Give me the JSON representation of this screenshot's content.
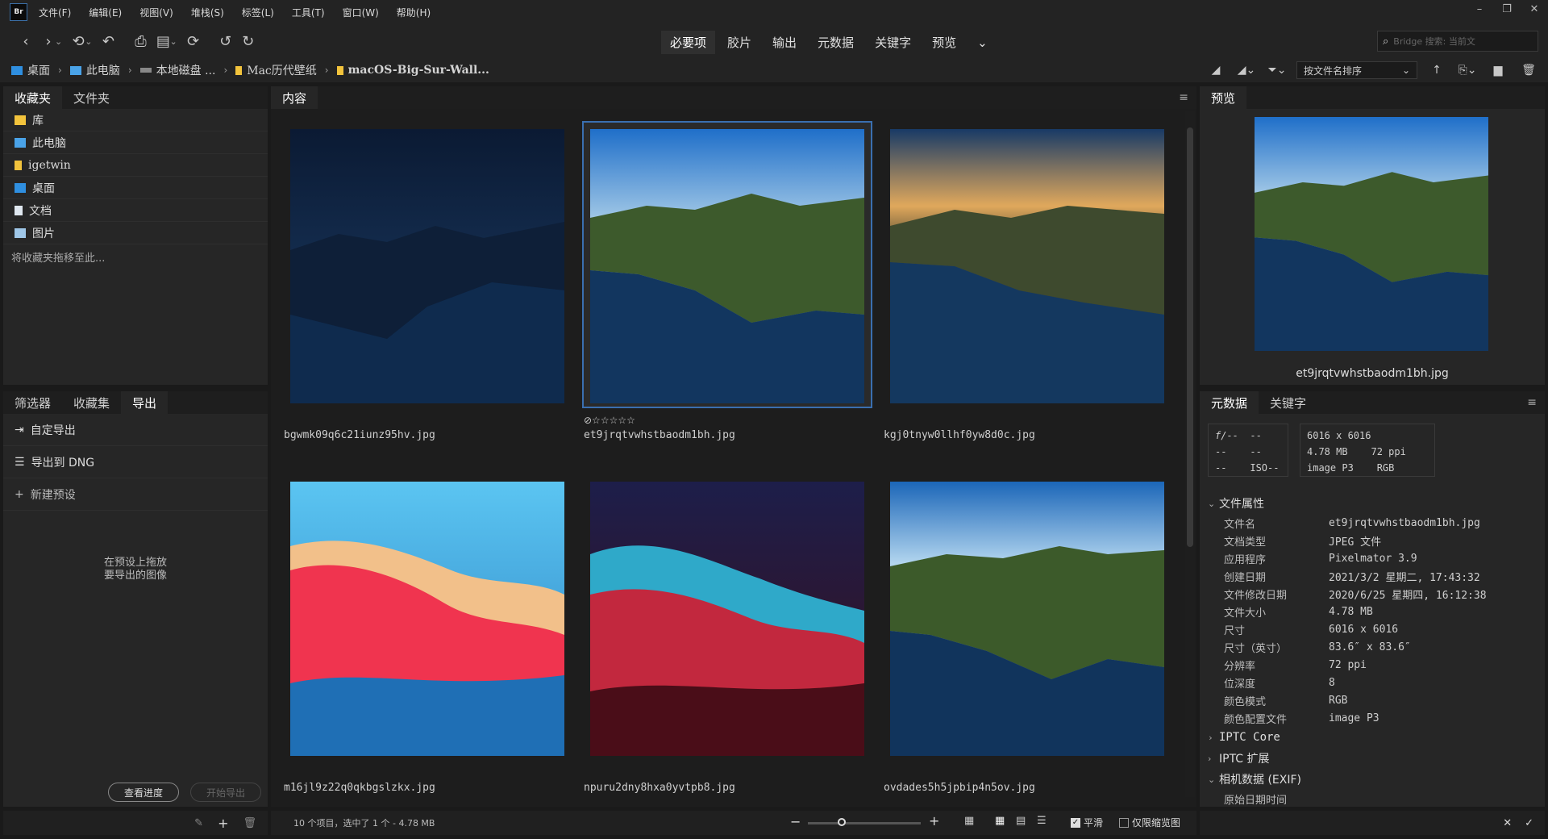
{
  "app": {
    "icon": "Br"
  },
  "menu": [
    "文件(F)",
    "编辑(E)",
    "视图(V)",
    "堆栈(S)",
    "标签(L)",
    "工具(T)",
    "窗口(W)",
    "帮助(H)"
  ],
  "workspaces": [
    "必要项",
    "胶片",
    "输出",
    "元数据",
    "关键字",
    "预览"
  ],
  "search": {
    "placeholder": "Bridge 搜索: 当前文"
  },
  "path": [
    "桌面",
    "此电脑",
    "本地磁盘 ...",
    "Mac历代壁纸",
    "macOS-Big-Sur-Wall..."
  ],
  "sort": {
    "label": "按文件名排序"
  },
  "favorites": {
    "tabs": [
      "收藏夹",
      "文件夹"
    ],
    "items": [
      "库",
      "此电脑",
      "igetwin",
      "桌面",
      "文档",
      "图片"
    ],
    "hint": "将收藏夹拖移至此..."
  },
  "export": {
    "tabs": [
      "筛选器",
      "收藏集",
      "导出"
    ],
    "items": [
      "自定导出",
      "导出到 DNG",
      "新建预设"
    ],
    "drop_hint_1": "在预设上拖放",
    "drop_hint_2": "要导出的图像",
    "progress_btn": "查看进度",
    "start_btn": "开始导出"
  },
  "content": {
    "tab": "内容",
    "items": [
      {
        "name": "bgwmk09q6c21iunz95hv.jpg"
      },
      {
        "name": "et9jrqtvwhstbaodm1bh.jpg",
        "selected": true,
        "rating": "⊘☆☆☆☆☆"
      },
      {
        "name": "kgj0tnyw0llhf0yw8d0c.jpg"
      },
      {
        "name": "m16jl9z22q0qkbgslzkx.jpg"
      },
      {
        "name": "npuru2dny8hxa0yvtpb8.jpg"
      },
      {
        "name": "ovdades5h5jpbip4n5ov.jpg"
      }
    ],
    "status": "10 个项目，选中了 1 个 - 4.78 MB",
    "zoom_fraction": 0.3,
    "smooth_label": "平滑",
    "thumb_only_label": "仅限缩览图"
  },
  "preview": {
    "tab": "预览",
    "filename": "et9jrqtvwhstbaodm1bh.jpg"
  },
  "metadata": {
    "tabs": [
      "元数据",
      "关键字"
    ],
    "camera": {
      "f": "f/--",
      "a": "--",
      "b": "--",
      "c": "--",
      "d": "--",
      "iso": "ISO--"
    },
    "summary": {
      "dims": "6016 x 6016",
      "size": "4.78 MB",
      "ppi": "72 ppi",
      "profile": "image P3",
      "mode": "RGB"
    },
    "section_file": "文件属性",
    "rows": [
      {
        "k": "文件名",
        "v": "et9jrqtvwhstbaodm1bh.jpg"
      },
      {
        "k": "文档类型",
        "v": "JPEG 文件"
      },
      {
        "k": "应用程序",
        "v": "Pixelmator 3.9"
      },
      {
        "k": "创建日期",
        "v": "2021/3/2 星期二, 17:43:32"
      },
      {
        "k": "文件修改日期",
        "v": "2020/6/25 星期四, 16:12:38"
      },
      {
        "k": "文件大小",
        "v": "4.78 MB"
      },
      {
        "k": "尺寸",
        "v": "6016 x 6016"
      },
      {
        "k": "尺寸（英寸）",
        "v": "83.6″ x 83.6″"
      },
      {
        "k": "分辨率",
        "v": "72 ppi"
      },
      {
        "k": "位深度",
        "v": "8"
      },
      {
        "k": "颜色模式",
        "v": "RGB"
      },
      {
        "k": "颜色配置文件",
        "v": "image P3"
      }
    ],
    "sections": [
      "IPTC Core",
      "IPTC 扩展",
      "相机数据 (EXIF)"
    ],
    "exif_first": "原始日期时间"
  }
}
